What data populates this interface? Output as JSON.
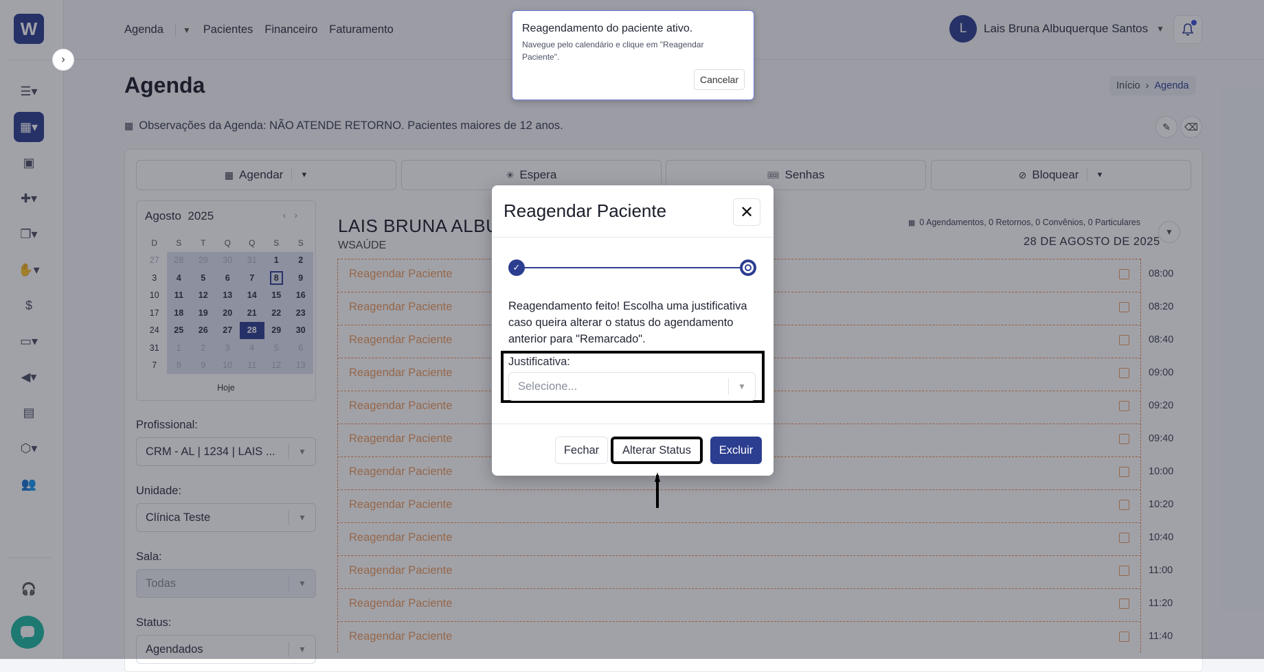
{
  "sidebar": {
    "logo_text": "W",
    "toggle_icon": "chevron-right-icon",
    "items": [
      {
        "icon": "list-icon"
      },
      {
        "icon": "calendar-icon",
        "active": true
      },
      {
        "icon": "id-card-icon"
      },
      {
        "icon": "medical-bag-icon"
      },
      {
        "icon": "documents-icon"
      },
      {
        "icon": "pill-hand-icon"
      },
      {
        "icon": "dollar-icon"
      },
      {
        "icon": "monitor-icon"
      },
      {
        "icon": "megaphone-icon"
      },
      {
        "icon": "notebook-icon"
      },
      {
        "icon": "box-icon"
      },
      {
        "icon": "users-icon"
      },
      {
        "icon": "headset-icon"
      }
    ],
    "chat_icon": "chat-bubble-icon"
  },
  "header": {
    "nav": [
      "Agenda",
      "Pacientes",
      "Financeiro",
      "Faturamento"
    ],
    "user": {
      "initial": "L",
      "name": "Lais Bruna Albuquerque Santos"
    }
  },
  "page": {
    "title": "Agenda",
    "breadcrumb": {
      "home": "Início",
      "current": "Agenda"
    },
    "observations": "Observações da Agenda: NÃO ATENDE RETORNO. Pacientes maiores de 12 anos."
  },
  "actions": {
    "agendar": "Agendar",
    "espera": "Espera",
    "senhas": "Senhas",
    "bloquear": "Bloquear"
  },
  "calendar": {
    "month": "Agosto",
    "year": "2025",
    "weekdays": [
      "D",
      "S",
      "T",
      "Q",
      "Q",
      "S",
      "S"
    ],
    "today_label": "Hoje",
    "selected_day": "28",
    "today_day": "8"
  },
  "filters": {
    "profissional": {
      "label": "Profissional:",
      "value": "CRM - AL | 1234 | LAIS ..."
    },
    "unidade": {
      "label": "Unidade:",
      "value": "Clínica Teste"
    },
    "sala": {
      "label": "Sala:",
      "value": "Todas"
    },
    "status": {
      "label": "Status:",
      "value": "Agendados"
    }
  },
  "schedule": {
    "name": "LAIS BRUNA ALBU",
    "subtitle": "WSAÚDE",
    "stats": "0 Agendamentos, 0 Retornos, 0 Convênios, 0 Particulares",
    "date": "28 DE AGOSTO DE 2025",
    "slot_label": "Reagendar Paciente",
    "times": [
      "08:00",
      "08:20",
      "08:40",
      "09:00",
      "09:20",
      "09:40",
      "10:00",
      "10:20",
      "10:40",
      "11:00",
      "11:20",
      "11:40"
    ]
  },
  "toast": {
    "title": "Reagendamento do paciente ativo.",
    "body": "Navegue pelo calendário e clique em \"Reagendar Paciente\".",
    "cancel": "Cancelar"
  },
  "modal": {
    "title": "Reagendar Paciente",
    "message": "Reagendamento feito! Escolha uma justificativa caso queira alterar o status do agendamento anterior para \"Remarcado\".",
    "justificativa_label": "Justificativa:",
    "justificativa_placeholder": "Selecione...",
    "fechar": "Fechar",
    "alterar_status": "Alterar Status",
    "excluir": "Excluir"
  },
  "colors": {
    "primary": "#2c3e8f",
    "slot_orange": "#e8894a",
    "chat": "#1cb9a1"
  }
}
